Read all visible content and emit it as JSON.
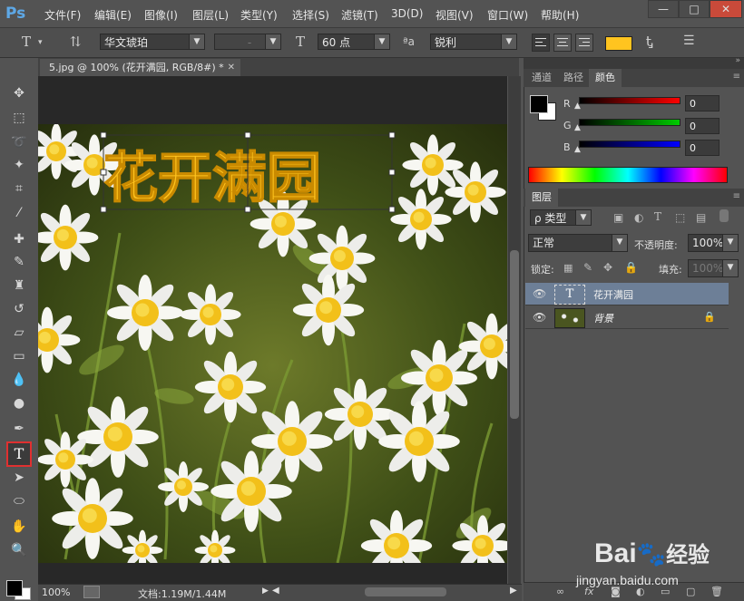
{
  "app": {
    "logo": "Ps",
    "menu": [
      "文件(F)",
      "编辑(E)",
      "图像(I)",
      "图层(L)",
      "类型(Y)",
      "选择(S)",
      "滤镜(T)",
      "3D(D)",
      "视图(V)",
      "窗口(W)",
      "帮助(H)"
    ],
    "window_buttons": [
      "—",
      "□",
      "✕"
    ]
  },
  "options": {
    "font_family": "华文琥珀",
    "font_style": "-",
    "font_size": "60 点",
    "aa_label": "ªa",
    "antialias": "锐利",
    "text_color": "#ffc41f"
  },
  "document": {
    "tab_title": "5.jpg @ 100% (花开满园, RGB/8#) *",
    "canvas_text": "花开满园",
    "text_color": "#ffc41f"
  },
  "statusbar": {
    "zoom": "100%",
    "doc_info": "文档:1.19M/1.44M"
  },
  "color_panel": {
    "tabs": [
      "通道",
      "路径",
      "颜色"
    ],
    "active_tab": "颜色",
    "channels": [
      {
        "label": "R",
        "value": "0"
      },
      {
        "label": "G",
        "value": "0"
      },
      {
        "label": "B",
        "value": "0"
      }
    ]
  },
  "layers_panel": {
    "tab": "图层",
    "filter_label": "ρ 类型",
    "blend_mode": "正常",
    "opacity_label": "不透明度:",
    "opacity_value": "100%",
    "lock_label": "锁定:",
    "fill_label": "填充:",
    "fill_value": "100%",
    "layers": [
      {
        "name": "花开满园",
        "type": "text",
        "selected": true
      },
      {
        "name": "背景",
        "type": "image",
        "locked": true,
        "selected": false
      }
    ]
  },
  "watermark": {
    "brand": "Bai",
    "brand2": "经验",
    "url": "jingyan.baidu.com"
  }
}
